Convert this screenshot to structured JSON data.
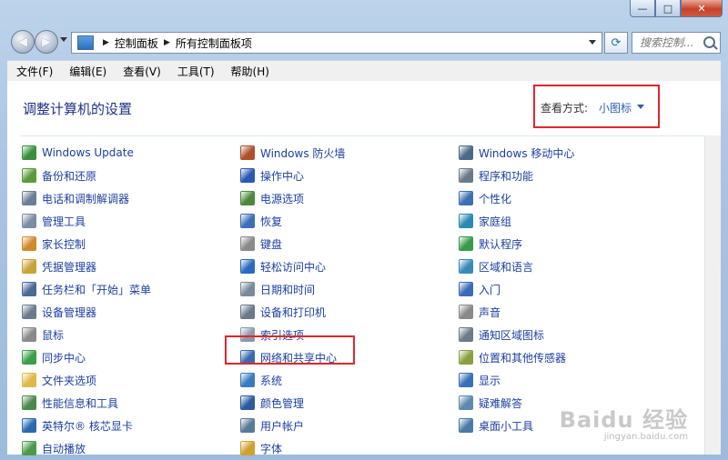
{
  "window": {
    "minimize_glyph": "—",
    "maximize_glyph": "□",
    "close_glyph": "✕"
  },
  "nav": {
    "back_glyph": "◀",
    "forward_glyph": "▶",
    "breadcrumb": [
      "控制面板",
      "所有控制面板项"
    ],
    "separator_glyph": "▶",
    "refresh_glyph": "⟳",
    "search_placeholder": "搜索控制..."
  },
  "menubar": [
    "文件(F)",
    "编辑(E)",
    "查看(V)",
    "工具(T)",
    "帮助(H)"
  ],
  "header": {
    "title": "调整计算机的设置",
    "view_by_label": "查看方式:",
    "view_by_value": "小图标"
  },
  "columns": [
    [
      {
        "label": "Windows Update",
        "icon": "windows-update-icon",
        "color": "#3a8f3a"
      },
      {
        "label": "备份和还原",
        "icon": "backup-icon",
        "color": "#5a9a3a"
      },
      {
        "label": "电话和调制解调器",
        "icon": "phone-modem-icon",
        "color": "#6a7f96"
      },
      {
        "label": "管理工具",
        "icon": "admin-tools-icon",
        "color": "#7a8da3"
      },
      {
        "label": "家长控制",
        "icon": "parental-controls-icon",
        "color": "#d08a2a"
      },
      {
        "label": "凭据管理器",
        "icon": "credential-manager-icon",
        "color": "#c9a33a"
      },
      {
        "label": "任务栏和「开始」菜单",
        "icon": "taskbar-icon",
        "color": "#4a6b93"
      },
      {
        "label": "设备管理器",
        "icon": "device-manager-icon",
        "color": "#6b7b8c"
      },
      {
        "label": "鼠标",
        "icon": "mouse-icon",
        "color": "#8a8a8a"
      },
      {
        "label": "同步中心",
        "icon": "sync-center-icon",
        "color": "#3aa04a"
      },
      {
        "label": "文件夹选项",
        "icon": "folder-options-icon",
        "color": "#e0b84a"
      },
      {
        "label": "性能信息和工具",
        "icon": "performance-icon",
        "color": "#4a8a4a"
      },
      {
        "label": "英特尔® 核芯显卡",
        "icon": "intel-graphics-icon",
        "color": "#2a6ab0"
      },
      {
        "label": "自动播放",
        "icon": "autoplay-icon",
        "color": "#4a9a4a"
      }
    ],
    [
      {
        "label": "Windows 防火墙",
        "icon": "firewall-icon",
        "color": "#b0502a"
      },
      {
        "label": "操作中心",
        "icon": "action-center-icon",
        "color": "#2a5ab0"
      },
      {
        "label": "电源选项",
        "icon": "power-options-icon",
        "color": "#4a8a3a"
      },
      {
        "label": "恢复",
        "icon": "recovery-icon",
        "color": "#3a70b8"
      },
      {
        "label": "键盘",
        "icon": "keyboard-icon",
        "color": "#8a8a8a"
      },
      {
        "label": "轻松访问中心",
        "icon": "ease-of-access-icon",
        "color": "#2a6ac0"
      },
      {
        "label": "日期和时间",
        "icon": "date-time-icon",
        "color": "#7a8a9a"
      },
      {
        "label": "设备和打印机",
        "icon": "devices-printers-icon",
        "color": "#6a7a8a"
      },
      {
        "label": "索引选项",
        "icon": "indexing-icon",
        "color": "#8a9aaa"
      },
      {
        "label": "网络和共享中心",
        "icon": "network-sharing-icon",
        "color": "#3a6ab0"
      },
      {
        "label": "系统",
        "icon": "system-icon",
        "color": "#3a7ac0"
      },
      {
        "label": "颜色管理",
        "icon": "color-management-icon",
        "color": "#2a5aa0"
      },
      {
        "label": "用户帐户",
        "icon": "user-accounts-icon",
        "color": "#5a7a9a"
      },
      {
        "label": "字体",
        "icon": "fonts-icon",
        "color": "#d0a030"
      }
    ],
    [
      {
        "label": "Windows 移动中心",
        "icon": "mobility-center-icon",
        "color": "#4a6a8a"
      },
      {
        "label": "程序和功能",
        "icon": "programs-features-icon",
        "color": "#6a7a8a"
      },
      {
        "label": "个性化",
        "icon": "personalization-icon",
        "color": "#3a70b0"
      },
      {
        "label": "家庭组",
        "icon": "homegroup-icon",
        "color": "#2a8ab0"
      },
      {
        "label": "默认程序",
        "icon": "default-programs-icon",
        "color": "#3a9a4a"
      },
      {
        "label": "区域和语言",
        "icon": "region-language-icon",
        "color": "#3a8ab8"
      },
      {
        "label": "入门",
        "icon": "getting-started-icon",
        "color": "#3a6ab8"
      },
      {
        "label": "声音",
        "icon": "sound-icon",
        "color": "#8a8a8a"
      },
      {
        "label": "通知区域图标",
        "icon": "notification-icons-icon",
        "color": "#6a7a8a"
      },
      {
        "label": "位置和其他传感器",
        "icon": "location-sensors-icon",
        "color": "#8aa040"
      },
      {
        "label": "显示",
        "icon": "display-icon",
        "color": "#3a70b8"
      },
      {
        "label": "疑难解答",
        "icon": "troubleshooting-icon",
        "color": "#5a8ab0"
      },
      {
        "label": "桌面小工具",
        "icon": "gadgets-icon",
        "color": "#4a7aa8"
      }
    ]
  ],
  "watermark": {
    "text": "Baidu 经验",
    "sub": "jingyan.baidu.com"
  }
}
